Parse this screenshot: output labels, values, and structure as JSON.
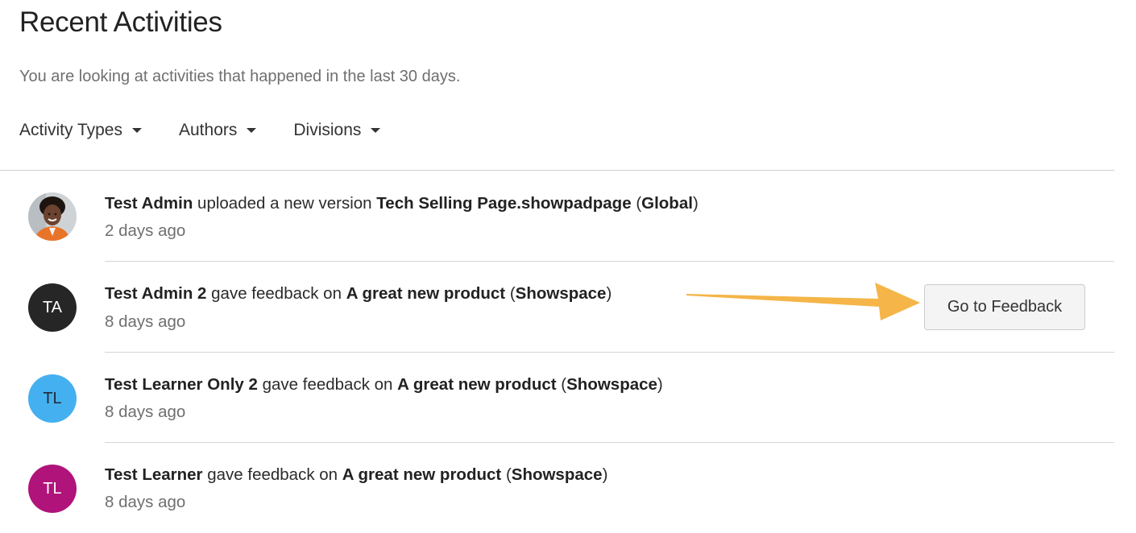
{
  "header": {
    "title": "Recent Activities",
    "subtitle": "You are looking at activities that happened in the last 30 days."
  },
  "filters": [
    {
      "label": "Activity Types",
      "icon": "caret-down-icon"
    },
    {
      "label": "Authors",
      "icon": "caret-down-icon"
    },
    {
      "label": "Divisions",
      "icon": "caret-down-icon"
    }
  ],
  "activities": [
    {
      "avatar": {
        "type": "photo",
        "initials": ""
      },
      "author": "Test Admin",
      "action": "uploaded a new version",
      "target": "Tech Selling Page.showpadpage",
      "scope": "Global",
      "time": "2 days ago"
    },
    {
      "avatar": {
        "type": "initials",
        "initials": "TA",
        "color": "#262626"
      },
      "author": "Test Admin 2",
      "action": "gave feedback on",
      "target": "A great new product",
      "scope": "Showspace",
      "time": "8 days ago"
    },
    {
      "avatar": {
        "type": "initials",
        "initials": "TL",
        "color": "#45b0f0"
      },
      "author": "Test Learner Only 2",
      "action": "gave feedback on",
      "target": "A great new product",
      "scope": "Showspace",
      "time": "8 days ago"
    },
    {
      "avatar": {
        "type": "initials",
        "initials": "TL",
        "color": "#b0137a"
      },
      "author": "Test Learner",
      "action": "gave feedback on",
      "target": "A great new product",
      "scope": "Showspace",
      "time": "8 days ago"
    }
  ],
  "paren_open": "(",
  "paren_close": ")",
  "feedback_button": {
    "label": "Go to Feedback"
  },
  "annotation": {
    "icon": "callout-arrow-icon",
    "color": "#f5b548"
  }
}
